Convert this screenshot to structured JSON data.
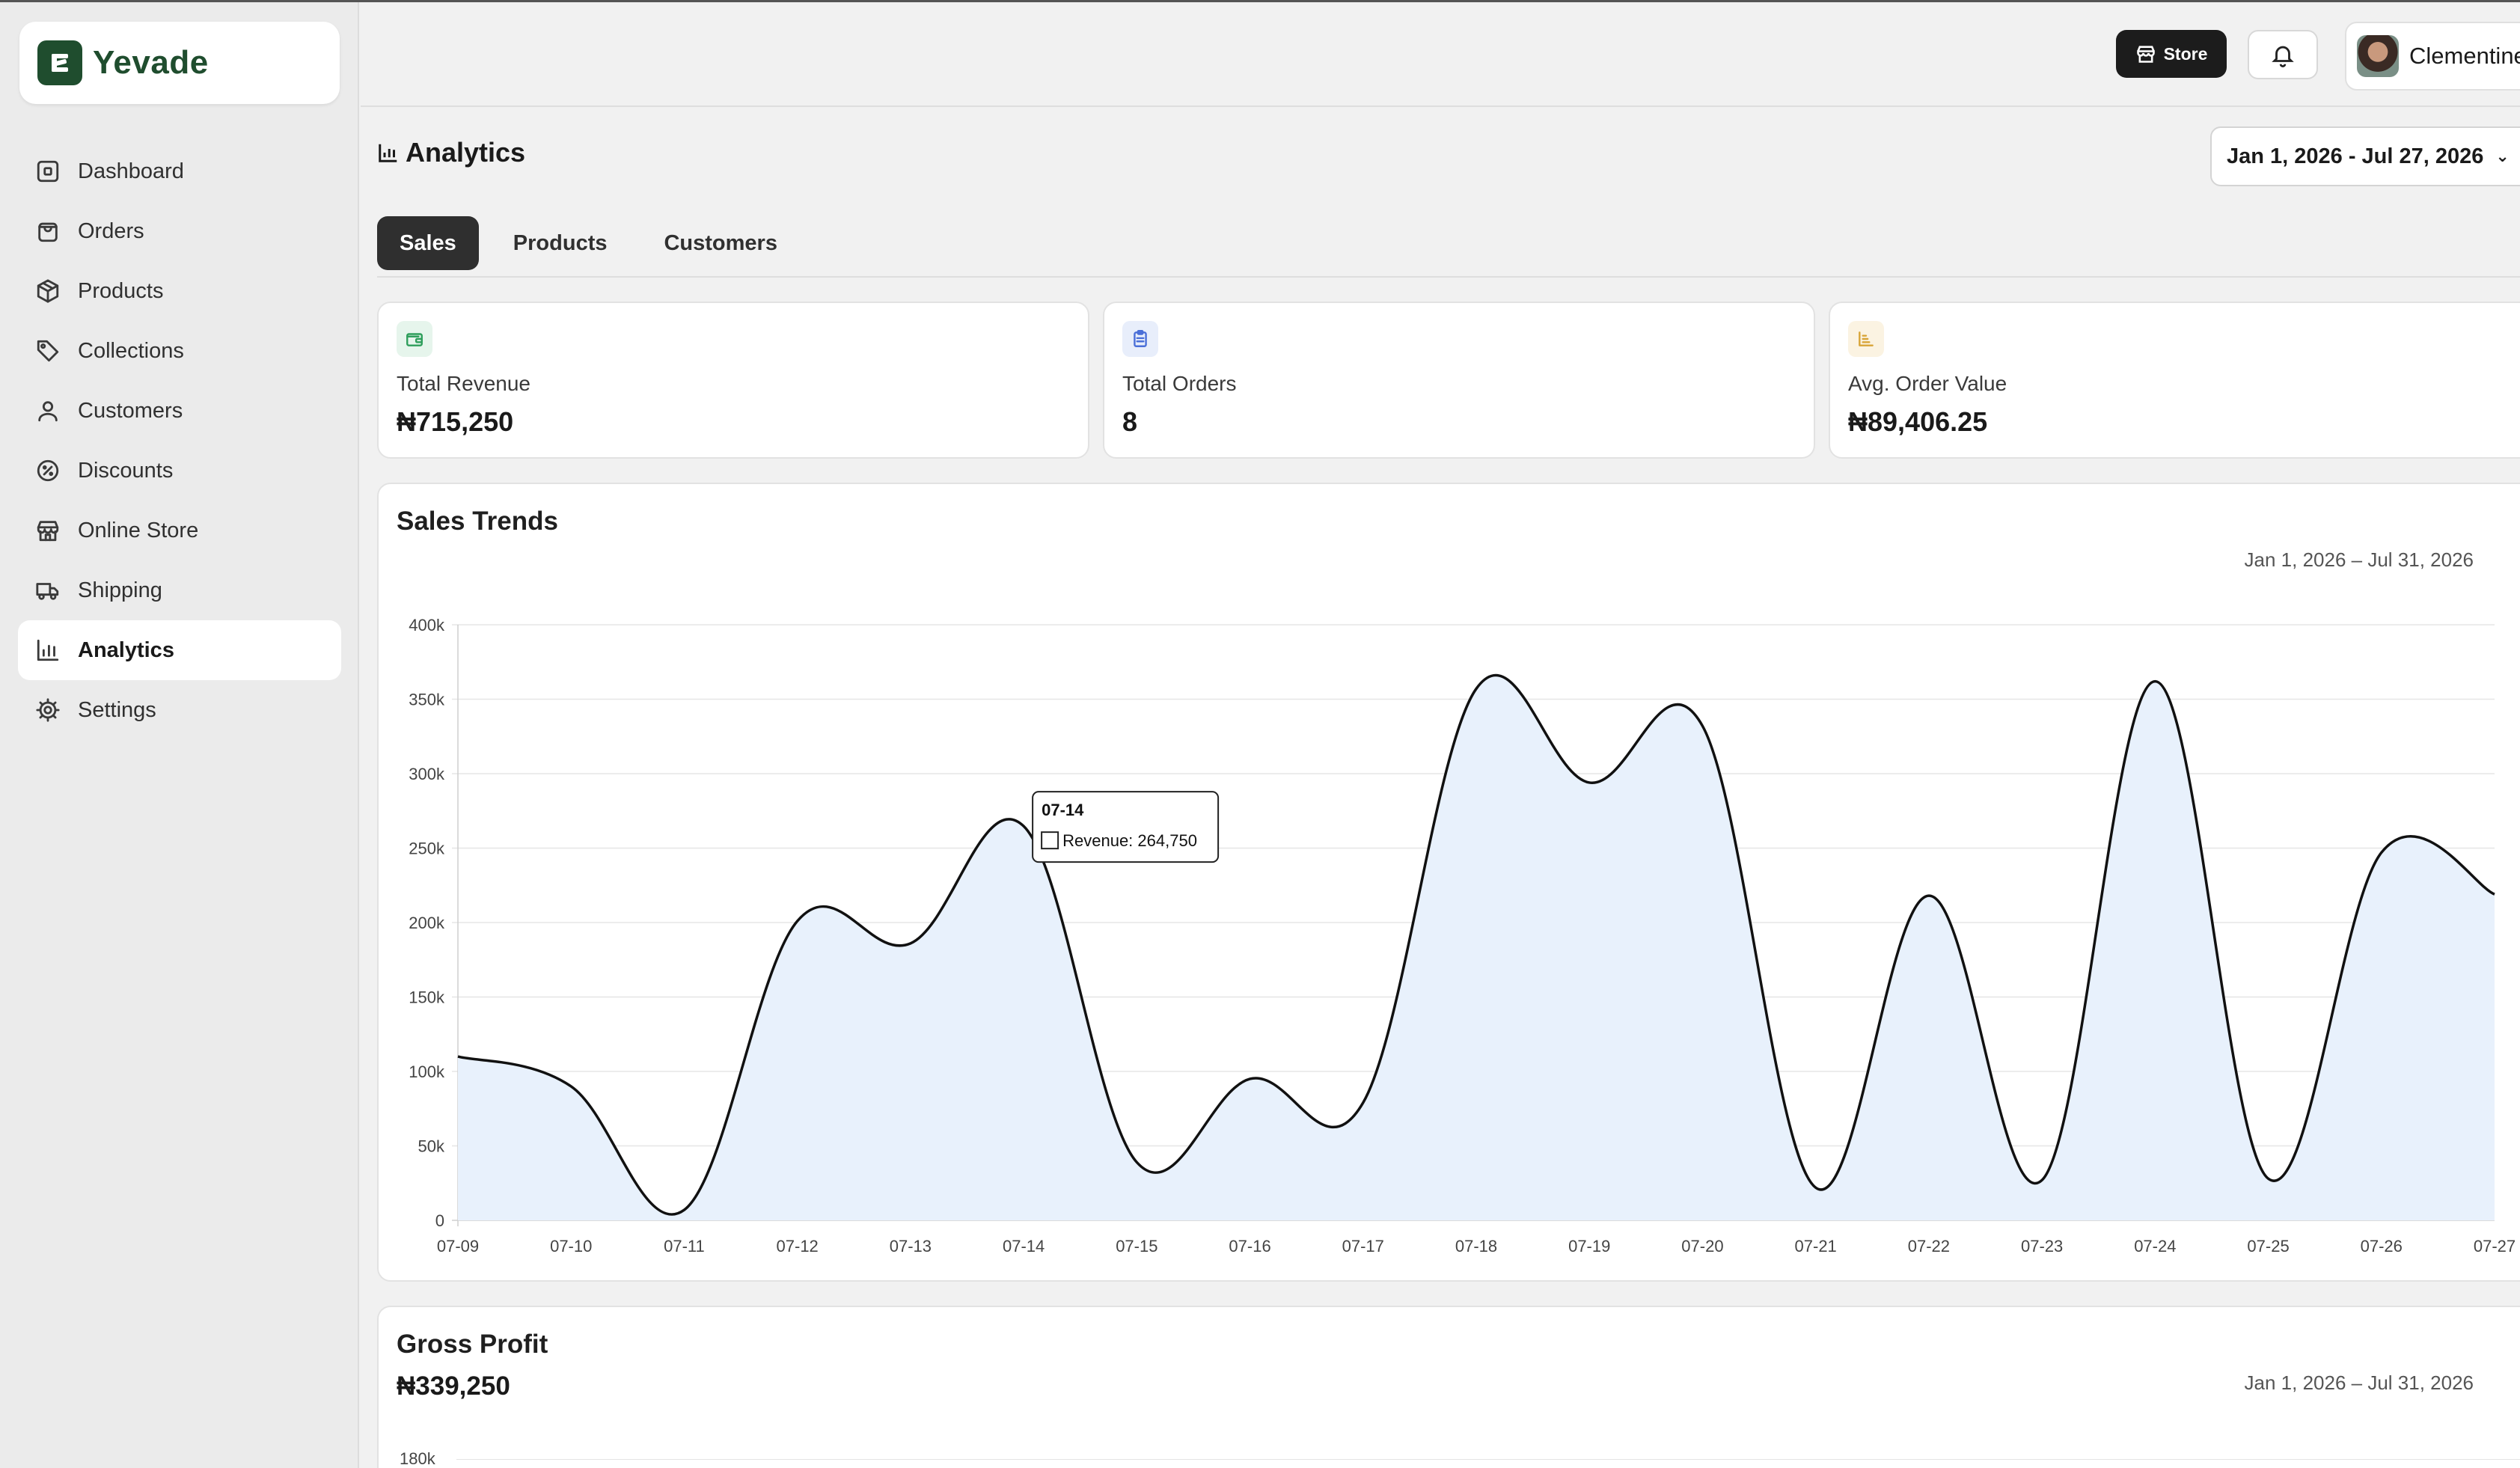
{
  "brand": {
    "name": "Yevade"
  },
  "sidebar": {
    "items": [
      {
        "label": "Dashboard",
        "icon": "dashboard-icon"
      },
      {
        "label": "Orders",
        "icon": "shopping-bag-icon"
      },
      {
        "label": "Products",
        "icon": "box-icon"
      },
      {
        "label": "Collections",
        "icon": "tag-icon"
      },
      {
        "label": "Customers",
        "icon": "user-icon"
      },
      {
        "label": "Discounts",
        "icon": "discount-icon"
      },
      {
        "label": "Online Store",
        "icon": "store-icon"
      },
      {
        "label": "Shipping",
        "icon": "truck-icon"
      },
      {
        "label": "Analytics",
        "icon": "bar-chart-icon",
        "active": true
      },
      {
        "label": "Settings",
        "icon": "gear-icon"
      }
    ]
  },
  "topbar": {
    "store_label": "Store",
    "user_name": "Clementine"
  },
  "page": {
    "title": "Analytics",
    "date_range": "Jan 1, 2026 - Jul 27, 2026",
    "tabs": [
      {
        "label": "Sales",
        "active": true
      },
      {
        "label": "Products"
      },
      {
        "label": "Customers"
      }
    ]
  },
  "stats": [
    {
      "label": "Total Revenue",
      "value": "₦715,250",
      "icon": "wallet-icon",
      "color": "#2e9e5b"
    },
    {
      "label": "Total Orders",
      "value": "8",
      "icon": "clipboard-icon",
      "color": "#4a6fd8"
    },
    {
      "label": "Avg. Order Value",
      "value": "₦89,406.25",
      "icon": "chart-icon",
      "color": "#d8a437"
    }
  ],
  "sales_trends": {
    "title": "Sales Trends",
    "range": "Jan 1, 2026 – Jul 31, 2026",
    "tooltip": {
      "title": "07-14",
      "label": "Revenue: 264,750"
    }
  },
  "gross_profit": {
    "title": "Gross Profit",
    "value": "₦339,250",
    "range": "Jan 1, 2026 – Jul 31, 2026",
    "first_tick": "180k"
  },
  "chart_data": {
    "type": "area",
    "x": [
      "07-09",
      "07-10",
      "07-11",
      "07-12",
      "07-13",
      "07-14",
      "07-15",
      "07-16",
      "07-17",
      "07-18",
      "07-19",
      "07-20",
      "07-21",
      "07-22",
      "07-23",
      "07-24",
      "07-25",
      "07-26",
      "07-27"
    ],
    "series": [
      {
        "name": "Revenue",
        "values": [
          110000,
          90000,
          7000,
          201000,
          186000,
          264750,
          39000,
          95000,
          79000,
          357000,
          294000,
          332000,
          22000,
          218000,
          27000,
          362000,
          28000,
          247000,
          219000
        ]
      }
    ],
    "yticks": [
      "0",
      "50k",
      "100k",
      "150k",
      "200k",
      "250k",
      "300k",
      "350k",
      "400k"
    ],
    "ylim": [
      0,
      400000
    ],
    "grid": true,
    "line_color": "#111111",
    "fill_color": "#e8f1fc"
  }
}
